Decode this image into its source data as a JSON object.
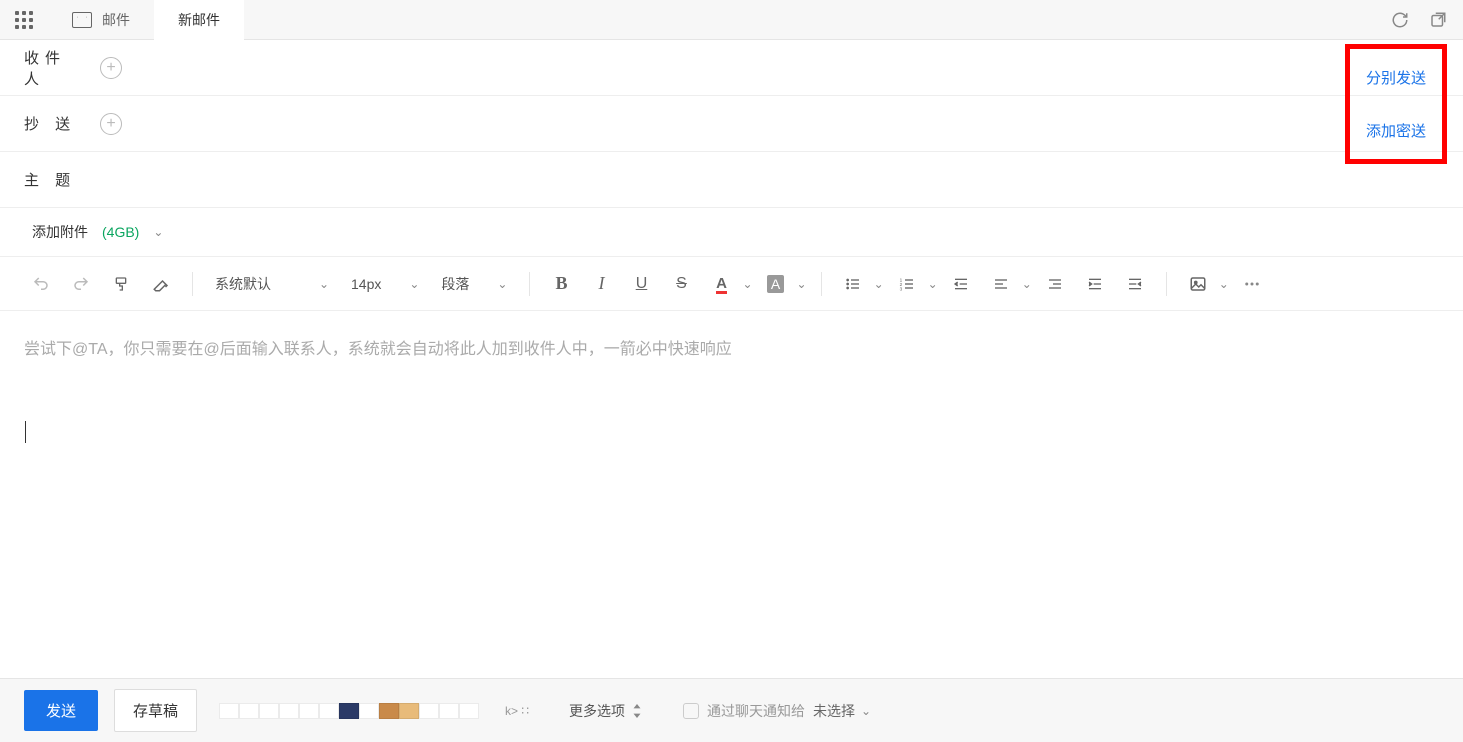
{
  "topbar": {
    "mail_tab": "邮件",
    "compose_tab": "新邮件"
  },
  "fields": {
    "to_label": "收件人",
    "cc_label": "抄 送",
    "subject_label": "主 题",
    "send_separately": "分别发送",
    "add_bcc": "添加密送"
  },
  "attach": {
    "label": "添加附件",
    "size": "(4GB)"
  },
  "toolbar": {
    "font_family": "系统默认",
    "font_size": "14px",
    "paragraph": "段落"
  },
  "editor": {
    "placeholder": "尝试下@TA，你只需要在@后面输入联系人，系统就会自动将此人加到收件人中，一箭必中快速响应"
  },
  "bottom": {
    "send": "发送",
    "draft": "存草稿",
    "kcode": "k> ∷",
    "more_options": "更多选项",
    "notify_label": "通过聊天通知给",
    "notify_value": "未选择",
    "swatches": [
      "#ffffff",
      "#ffffff",
      "#ffffff",
      "#ffffff",
      "#ffffff",
      "#ffffff",
      "#2b3a67",
      "#ffffff",
      "#c98a4a",
      "#e8bb7a",
      "#ffffff",
      "#ffffff",
      "#ffffff"
    ]
  }
}
